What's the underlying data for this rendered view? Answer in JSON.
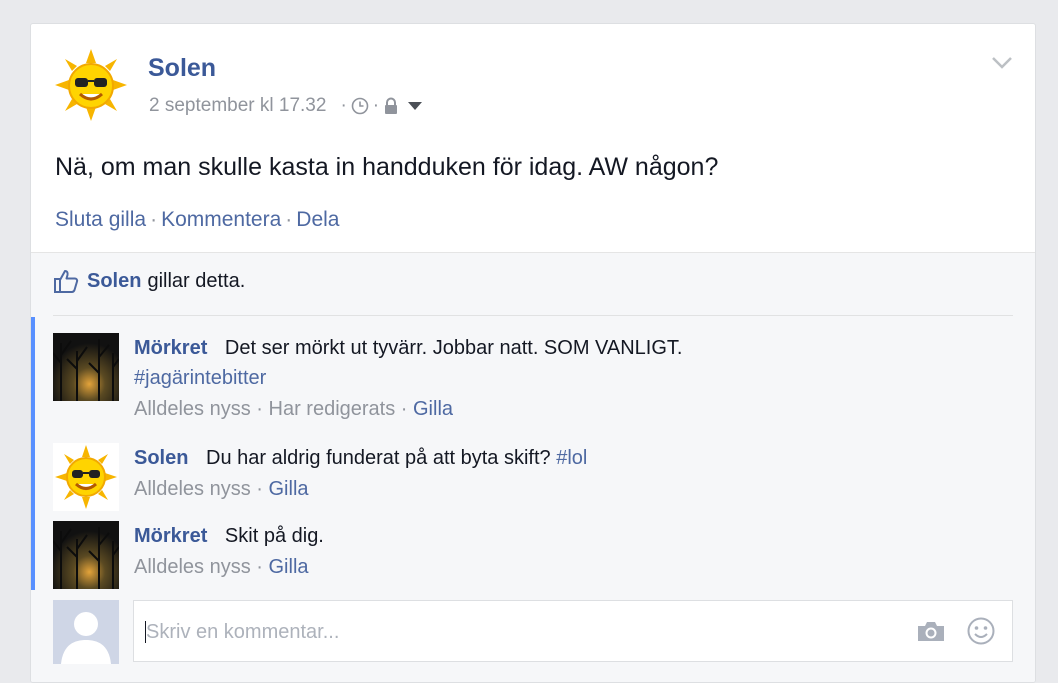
{
  "post": {
    "author": "Solen",
    "timestamp": "2 september kl 17.32",
    "text": "Nä, om man skulle kasta in handduken för idag. AW någon?",
    "actions": {
      "unlike": "Sluta gilla",
      "comment": "Kommentera",
      "share": "Dela"
    }
  },
  "likes": {
    "name": "Solen",
    "suffix": "gillar detta."
  },
  "comments": [
    {
      "author": "Mörkret",
      "text": "Det ser mörkt ut tyvärr. Jobbar natt. SOM VANLIGT.",
      "hashtag": "#jagärintebitter",
      "time": "Alldeles nyss",
      "edited": "Har redigerats",
      "like": "Gilla"
    },
    {
      "author": "Solen",
      "text": "Du har aldrig funderat på att byta skift?",
      "hashtag": "#lol",
      "time": "Alldeles nyss",
      "like": "Gilla"
    },
    {
      "author": "Mörkret",
      "text": "Skit på dig.",
      "time": "Alldeles nyss",
      "like": "Gilla"
    }
  ],
  "composer": {
    "placeholder": "Skriv en kommentar..."
  },
  "colors": {
    "link": "#3b5998",
    "accent_bar": "#5890ff",
    "muted": "#90949c"
  },
  "icons": [
    "chevron-down-icon",
    "clock-icon",
    "lock-icon",
    "caret-down-icon",
    "thumbs-up-icon",
    "camera-icon",
    "smiley-icon"
  ]
}
